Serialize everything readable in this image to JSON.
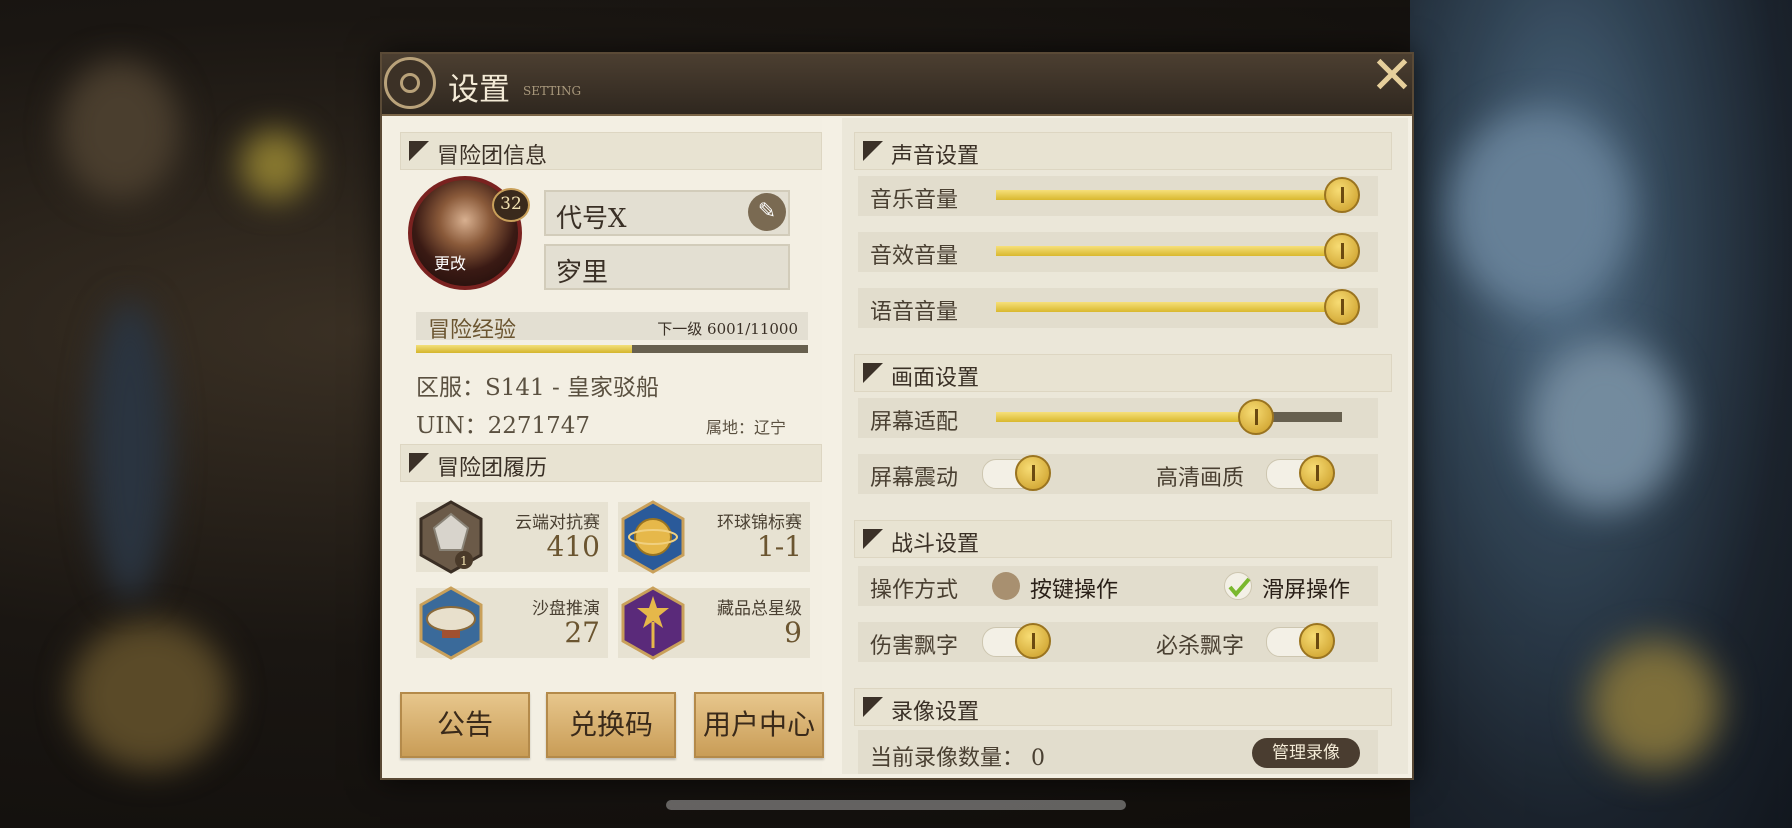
{
  "window": {
    "title": "设置",
    "subtitle": "SETTING"
  },
  "colors": {
    "accent_gold": "#d9b82e",
    "panel": "#f4f0e4",
    "button": "#d9b070"
  },
  "left": {
    "section_info": "冒险团信息",
    "avatar": {
      "level": "32",
      "change_label": "更改"
    },
    "name_value": "代号X",
    "name_edit_icon": "leaf-icon",
    "title_value": "穸里",
    "exp": {
      "label": "冒险经验",
      "next_label": "下一级 6001/11000",
      "progress": 0.55
    },
    "server": "区服：S141 - 皇家驳船",
    "uin": "UIN：2271747",
    "location": "属地：辽宁",
    "section_history": "冒险团履历",
    "cards": [
      {
        "name": "云端对抗赛",
        "value": "410",
        "icon": "silver-crest-icon",
        "rank": "1"
      },
      {
        "name": "环球锦标赛",
        "value": "1-1",
        "icon": "globe-trophy-icon"
      },
      {
        "name": "沙盘推演",
        "value": "27",
        "icon": "airship-icon"
      },
      {
        "name": "藏品总星级",
        "value": "9",
        "icon": "star-gem-icon"
      }
    ],
    "buttons": [
      "公告",
      "兑换码",
      "用户中心"
    ]
  },
  "right": {
    "section_sound": "声音设置",
    "sound": [
      {
        "label": "音乐音量",
        "value": 1.0
      },
      {
        "label": "音效音量",
        "value": 1.0
      },
      {
        "label": "语音音量",
        "value": 1.0
      }
    ],
    "section_display": "画面设置",
    "screen_fit": {
      "label": "屏幕适配",
      "value": 0.75
    },
    "screen_shake": {
      "label": "屏幕震动",
      "on": true
    },
    "hd_quality": {
      "label": "高清画质",
      "on": true
    },
    "section_battle": "战斗设置",
    "control_mode": {
      "label": "操作方式",
      "option1": "按键操作",
      "option2": "滑屏操作",
      "selected": "滑屏操作"
    },
    "damage_text": {
      "label": "伤害飘字",
      "on": true
    },
    "crit_text": {
      "label": "必杀飘字",
      "on": true
    },
    "section_record": "录像设置",
    "record_count": "当前录像数量：  0",
    "manage_label": "管理录像"
  }
}
